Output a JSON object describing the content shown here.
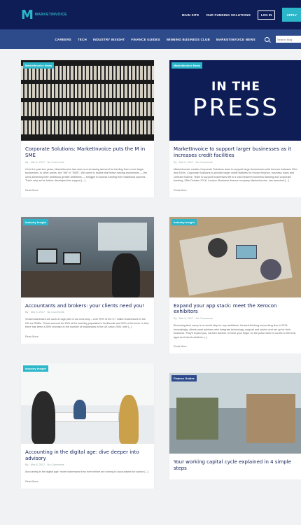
{
  "brand": {
    "logo_mark": "M",
    "logo_text": "MARKETINVOICE",
    "accent": "#2bb6c9",
    "navy": "#0e1d55",
    "nav_blue": "#2d4a8a"
  },
  "topbar": {
    "links": [
      "MAIN SITE",
      "OUR FUNDING SOLUTIONS"
    ],
    "login_label": "LOG IN",
    "apply_label": "APPLY"
  },
  "nav": {
    "items": [
      "CAREERS",
      "TECH",
      "INDUSTRY INSIGHT",
      "FINANCE GUIDES",
      "WINNING BUSINESS CLUB",
      "MARKETINVOICE NEWS"
    ],
    "search_placeholder": "Search blog"
  },
  "posts": [
    {
      "badge": "MarketInvoice News",
      "title": "Corporate Solutions: MarketInvoice puts the M in SME",
      "meta": "By  ·  Mar 8, 2017  ·  No Comments",
      "excerpt": "Over the past two years, MarketInvoice has seen an increasing demand for funding from much larger businesses, in other words, the \"Me\" in \"SME\". We came to realise that these thriving businesses — the ones achieving their ambitious growth ambitions — struggle to access funding from traditional sources. That's why we've further developed the support [...]",
      "read_more": "Read More"
    },
    {
      "badge": "MarketInvoice News",
      "title": "MarketInvoice to support larger businesses as it increases credit facilities",
      "meta": "By  ·  Mar 8, 2017  ·  No Comments",
      "excerpt": "MarketInvoice creates Corporate Solutions team to support larger businesses with turnover between £5m and £50m. Corporate Solutions to provide larger credit facilities for invoice finance, business loans and contract finance. Team to support businesses left in a void between business banking and corporate banking. 28th October 2016, London: Business finance company MarketInvoice, has launched [...]",
      "read_more": "Read More",
      "image_line1": "IN THE",
      "image_line2": "PRESS"
    },
    {
      "badge": "Industry Insight",
      "title": "Accountants and brokers: your clients need you!",
      "meta": "By  ·  Mar 8, 2017  ·  No Comments",
      "excerpt": "Small businesses are such a huge part of our economy – over 99% of the 5.7 million businesses in the UK are SMEs. These account for 60% of the working population's livelihoods and 50% of turnover. In fact, there has been a 55% increase in the number of businesses in the UK since 2000, with [...]",
      "read_more": "Read More"
    },
    {
      "badge": "Industry Insight",
      "title": "Expand your app stack: meet the Xerocon exhibitors",
      "meta": "By  ·  Mar 8, 2017  ·  No Comments",
      "excerpt": "Becoming tech savvy is a crucial step for any ambitious, forward-thinking accounting firm in 2016. Increasingly, clients want advisers who integrate technology, support and advice and set up for their business. They'll expect you, as their adviser, to have your finger on the pulse when it comes to the best apps and cloud solutions [...]",
      "read_more": "Read More"
    },
    {
      "badge": "Industry Insight",
      "title": "Accounting in the digital age: dive deeper into advisory",
      "meta": "By  ·  Mar 8, 2017  ·  No Comments",
      "excerpt": "Accounting in the digital age: more businesses than ever before are turning to accountants for advice [...]",
      "read_more": "Read More"
    },
    {
      "badge": "Finance Guides",
      "title": "Your working capital cycle explained in 4 simple steps",
      "meta": "",
      "excerpt": "",
      "read_more": ""
    }
  ]
}
